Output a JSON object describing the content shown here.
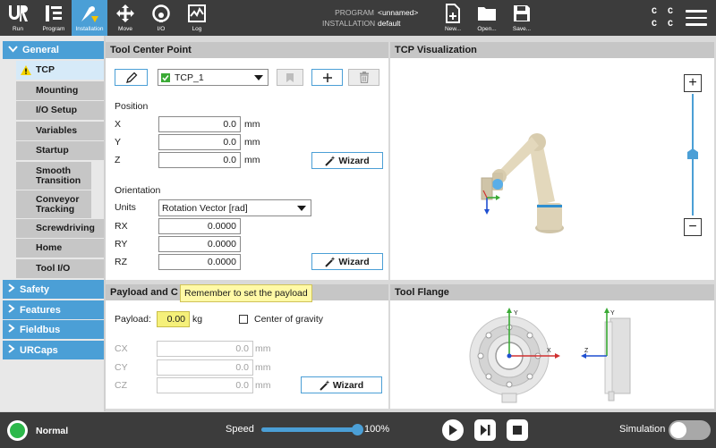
{
  "topbar": {
    "tabs": [
      {
        "label": "Run",
        "icon": "ur-logo-icon"
      },
      {
        "label": "Program",
        "icon": "program-icon"
      },
      {
        "label": "Installation",
        "icon": "installation-icon"
      },
      {
        "label": "Move",
        "icon": "move-icon"
      },
      {
        "label": "I/O",
        "icon": "io-icon"
      },
      {
        "label": "Log",
        "icon": "log-icon"
      }
    ],
    "program_key": "PROGRAM",
    "program_value": "<unnamed>",
    "installation_key": "INSTALLATION",
    "installation_value": "default",
    "file_buttons": [
      {
        "label": "New...",
        "icon": "new-file-icon"
      },
      {
        "label": "Open...",
        "icon": "folder-icon"
      },
      {
        "label": "Save...",
        "icon": "save-icon"
      }
    ],
    "cc_row1": "C C",
    "cc_row2": "C C"
  },
  "nav": {
    "general": "General",
    "items": [
      "TCP",
      "Mounting",
      "I/O Setup",
      "Variables",
      "Startup",
      "Smooth Transition",
      "Conveyor Tracking",
      "Screwdriving",
      "Home",
      "Tool I/O"
    ],
    "sections": [
      "Safety",
      "Features",
      "Fieldbus",
      "URCaps"
    ]
  },
  "tcp_panel": {
    "title": "Tool Center Point",
    "tcp_name": "TCP_1",
    "position_label": "Position",
    "x_label": "X",
    "x_value": "0.0",
    "y_label": "Y",
    "y_value": "0.0",
    "z_label": "Z",
    "z_value": "0.0",
    "unit_mm": "mm",
    "wizard": "Wizard",
    "orientation_label": "Orientation",
    "units_label": "Units",
    "units_value": "Rotation Vector [rad]",
    "rx_label": "RX",
    "rx_value": "0.0000",
    "ry_label": "RY",
    "ry_value": "0.0000",
    "rz_label": "RZ",
    "rz_value": "0.0000"
  },
  "viz_panel": {
    "title": "TCP Visualization",
    "zoom_in": "+",
    "zoom_out": "−",
    "zoom_level": 0.5
  },
  "payload_panel": {
    "title": "Payload and C",
    "tooltip": "Remember to set the payload",
    "payload_label": "Payload:",
    "payload_value": "0.00",
    "payload_unit": "kg",
    "cog_label": "Center of gravity",
    "cx_label": "CX",
    "cx_value": "0.0",
    "cy_label": "CY",
    "cy_value": "0.0",
    "cz_label": "CZ",
    "cz_value": "0.0",
    "unit_mm": "mm",
    "wizard": "Wizard"
  },
  "flange_panel": {
    "title": "Tool Flange",
    "axis_y": "Y",
    "axis_x": "X",
    "axis_z": "Z"
  },
  "bottombar": {
    "status": "Normal",
    "speed_label": "Speed",
    "speed_value": "100%",
    "speed_fraction": 1.0,
    "simulation_label": "Simulation",
    "colors": {
      "status_ok": "#2db84b",
      "accent": "#4b9fd6"
    }
  }
}
